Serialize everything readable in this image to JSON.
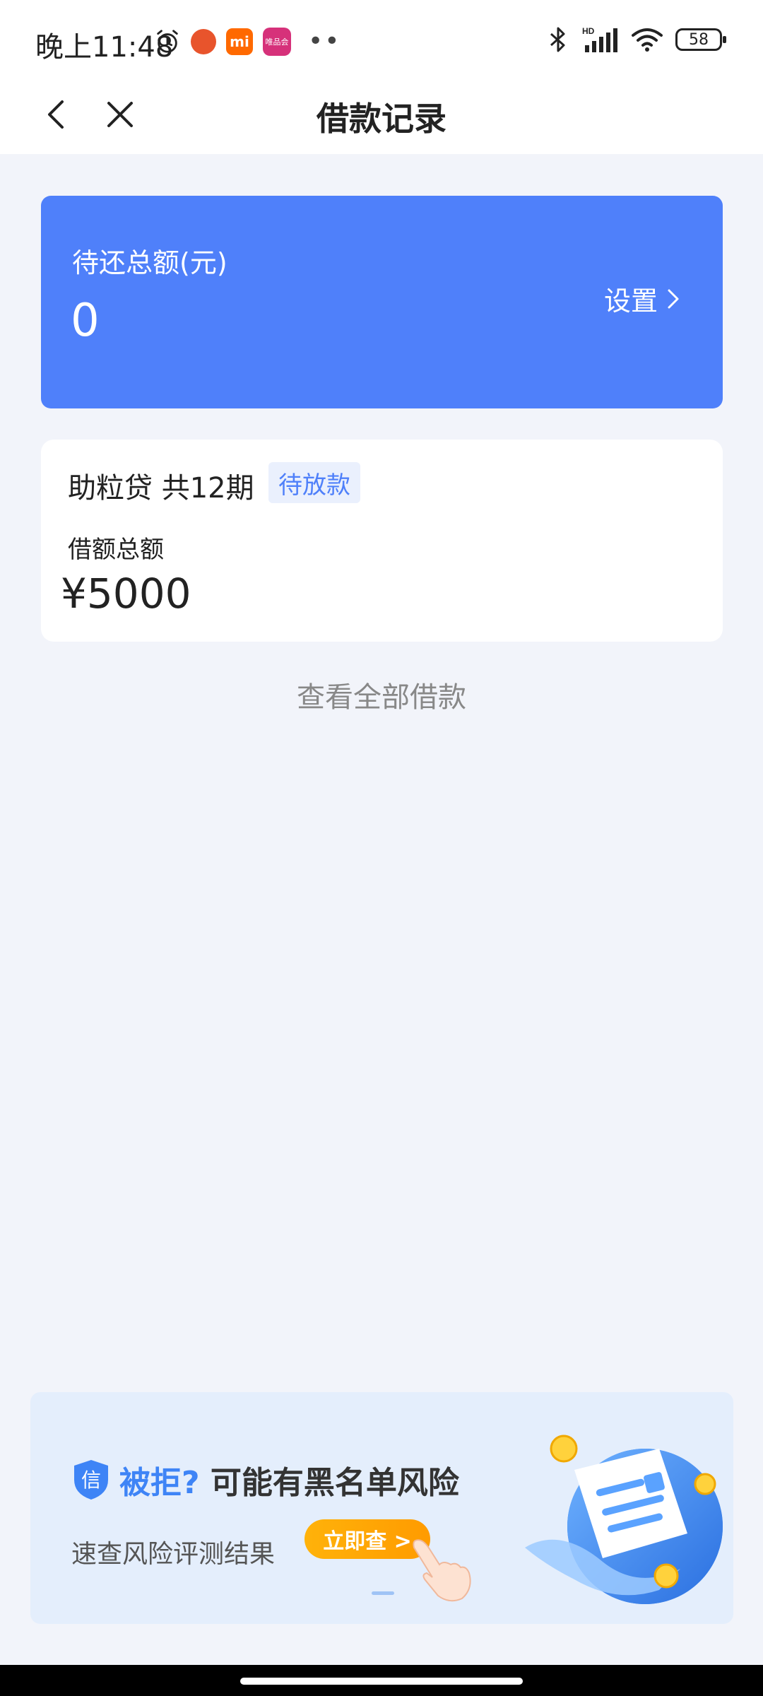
{
  "status_bar": {
    "time": "晚上11:48",
    "app2_label": "mi",
    "app3_label": "唯品会",
    "battery": "58"
  },
  "nav": {
    "title": "借款记录"
  },
  "summary": {
    "label": "待还总额(元)",
    "amount": "0",
    "settings_label": "设置"
  },
  "loan": {
    "product": "助粒贷 共12期",
    "status_badge": "待放款",
    "amount_label": "借额总额",
    "amount": "¥5000"
  },
  "view_all_label": "查看全部借款",
  "banner": {
    "shield_glyph": "信",
    "title_highlight": "被拒?",
    "title_rest": "可能有黑名单风险",
    "subtitle": "速查风险评测结果",
    "button_label": "立即查 >"
  },
  "colors": {
    "accent": "#4f80fa",
    "background": "#f2f4fa",
    "banner_bg": "#e4eefc",
    "cta": "#ffa800"
  }
}
